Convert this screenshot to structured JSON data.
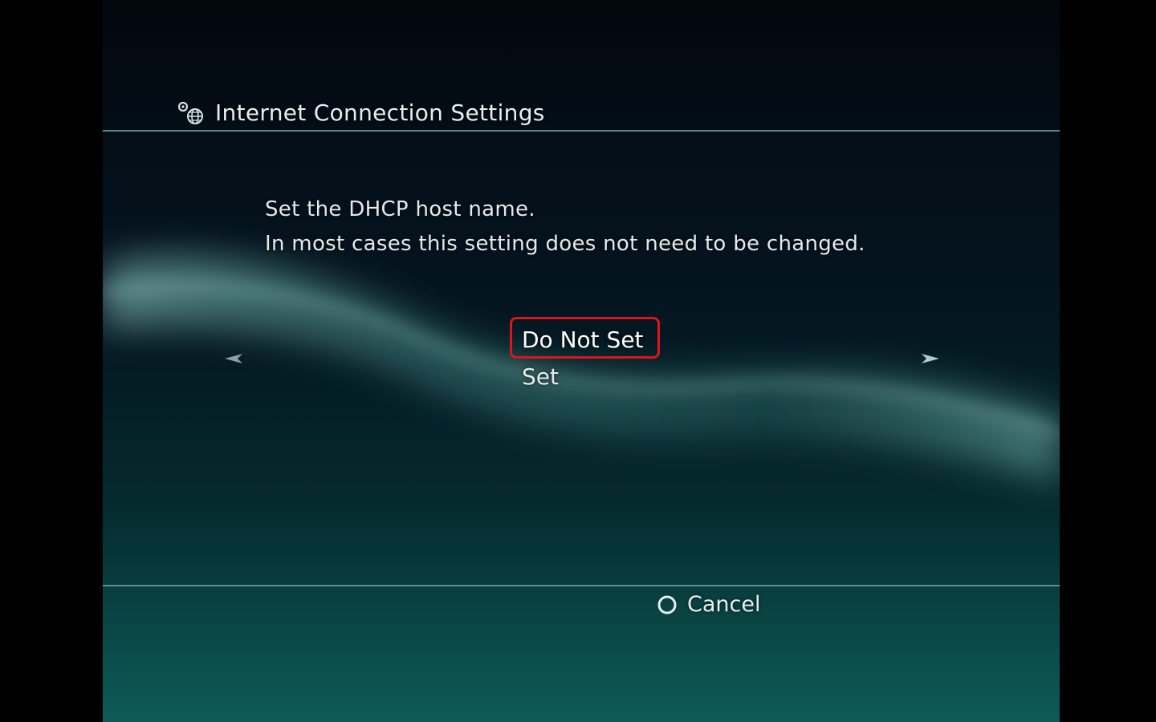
{
  "header": {
    "title": "Internet Connection Settings",
    "icon": "network-settings-icon"
  },
  "message": {
    "line1": "Set the DHCP host name.",
    "line2": "In most cases this setting does not need to be changed."
  },
  "options": [
    {
      "label": "Do Not Set",
      "selected": true
    },
    {
      "label": "Set",
      "selected": false
    }
  ],
  "footer": {
    "cancel_label": "Cancel",
    "cancel_icon": "circle-button-icon"
  },
  "colors": {
    "selection_border": "#e0131b",
    "text": "#e4eaec",
    "divider": "#6a9ca0",
    "background_top": "#02070d",
    "background_bottom": "#0f5a56"
  }
}
